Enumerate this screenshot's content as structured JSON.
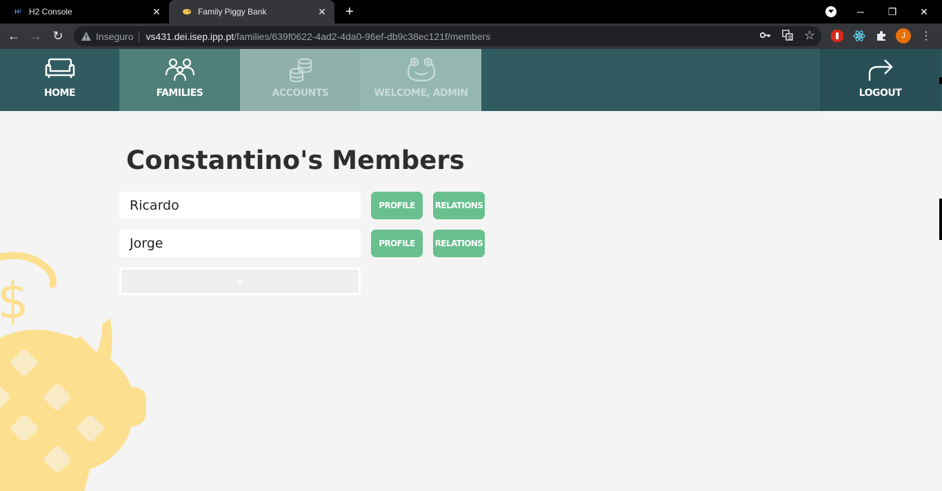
{
  "browser": {
    "tabs": [
      {
        "title": "H2 Console",
        "favicon": "h2-icon",
        "active": false
      },
      {
        "title": "Family Piggy Bank",
        "favicon": "piggy-bank-icon",
        "active": true
      }
    ],
    "new_tab_label": "+",
    "omnibox": {
      "security_label": "Inseguro",
      "host": "vs431.dei.isep.ipp.pt",
      "path": "/families/639f0622-4ad2-4da0-96ef-db9c38ec121f/members"
    },
    "profile_initial": "J"
  },
  "nav": {
    "home": "HOME",
    "families": "FAMILIES",
    "accounts": "ACCOUNTS",
    "welcome": "WELCOME, ADMIN",
    "logout": "LOGOUT"
  },
  "page": {
    "heading": "Constantino's Members",
    "members": [
      {
        "name": "Ricardo",
        "profile_label": "PROFILE",
        "relations_label": "RELATIONS"
      },
      {
        "name": "Jorge",
        "profile_label": "PROFILE",
        "relations_label": "RELATIONS"
      }
    ],
    "add_label": "+"
  },
  "colors": {
    "nav_bg": "#305b61",
    "nav_active": "#4f7f78",
    "button_green": "#68c08e",
    "piggy_yellow": "#fde08f"
  }
}
